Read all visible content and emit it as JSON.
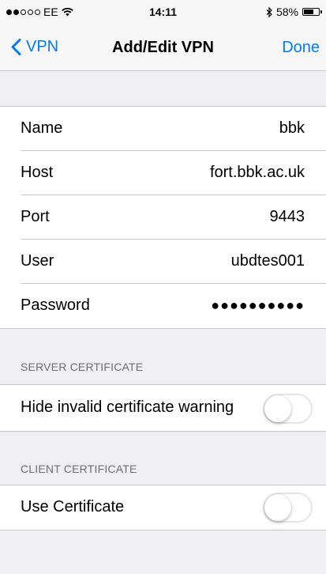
{
  "status_bar": {
    "carrier": "EE",
    "time": "14:11",
    "battery": "58%",
    "signal_bars_filled": 2,
    "signal_bars_total": 5
  },
  "nav": {
    "back_label": "VPN",
    "title": "Add/Edit VPN",
    "done_label": "Done"
  },
  "fields": {
    "name_label": "Name",
    "name_value": "bbk",
    "host_label": "Host",
    "host_value": "fort.bbk.ac.uk",
    "port_label": "Port",
    "port_value": "9443",
    "user_label": "User",
    "user_value": "ubdtes001",
    "password_label": "Password",
    "password_value": "●●●●●●●●●●"
  },
  "server_certificate": {
    "header": "SERVER CERTIFICATE",
    "hide_invalid_label": "Hide invalid certificate warning",
    "hide_invalid_on": false
  },
  "client_certificate": {
    "header": "CLIENT CERTIFICATE",
    "use_certificate_label": "Use Certificate",
    "use_certificate_on": false
  },
  "colors": {
    "accent": "#007aff",
    "background": "#efeff4",
    "separator": "#c8c7cc",
    "section_header": "#6d6d72"
  }
}
